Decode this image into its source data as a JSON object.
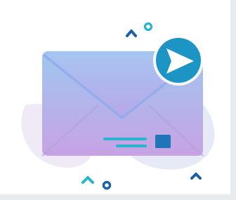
{
  "illustration": {
    "subject": "email-send",
    "colors": {
      "background_blob": "#e8eaf5",
      "envelope_top": "#9fc7f0",
      "envelope_bottom": "#c7a2e4",
      "envelope_flap": "#a4b8ee",
      "send_badge": "#1c94c4",
      "send_arrow": "#ffffff",
      "accent_teal": "#29b3cf",
      "accent_navy": "#1f5fa6",
      "frame_border": "#e9ecee"
    },
    "icons": [
      "envelope-icon",
      "send-arrow-icon",
      "caret-up-icon",
      "circle-ring-icon"
    ]
  }
}
